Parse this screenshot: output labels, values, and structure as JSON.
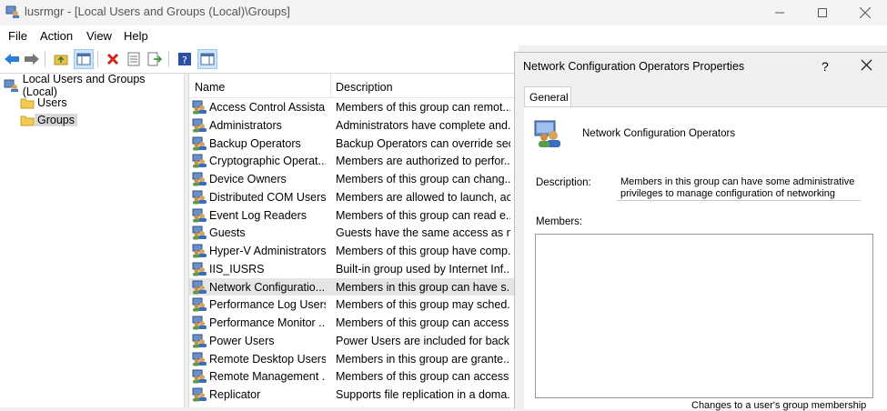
{
  "window": {
    "title": "lusrmgr - [Local Users and Groups (Local)\\Groups]"
  },
  "menu": [
    "File",
    "Action",
    "View",
    "Help"
  ],
  "toolbar_icons": [
    "back-arrow-icon",
    "forward-arrow-icon",
    "up-folder-icon",
    "show-hide-tree-icon",
    "delete-icon",
    "properties-icon",
    "export-list-icon",
    "help-icon",
    "show-hide-action-pane-icon"
  ],
  "tree": {
    "root": "Local Users and Groups (Local)",
    "children": [
      "Users",
      "Groups"
    ],
    "selected": "Groups"
  },
  "list": {
    "columns": [
      "Name",
      "Description"
    ],
    "rows": [
      {
        "name": "Access Control Assista...",
        "desc": "Members of this group can remot..."
      },
      {
        "name": "Administrators",
        "desc": "Administrators have complete and..."
      },
      {
        "name": "Backup Operators",
        "desc": "Backup Operators can override sec..."
      },
      {
        "name": "Cryptographic Operat...",
        "desc": "Members are authorized to perfor..."
      },
      {
        "name": "Device Owners",
        "desc": "Members of this group can chang..."
      },
      {
        "name": "Distributed COM Users",
        "desc": "Members are allowed to launch, ac..."
      },
      {
        "name": "Event Log Readers",
        "desc": "Members of this group can read e..."
      },
      {
        "name": "Guests",
        "desc": "Guests have the same access as m..."
      },
      {
        "name": "Hyper-V Administrators",
        "desc": "Members of this group have comp..."
      },
      {
        "name": "IIS_IUSRS",
        "desc": "Built-in group used by Internet Inf..."
      },
      {
        "name": "Network Configuratio...",
        "desc": "Members in this group can have s...",
        "selected": true
      },
      {
        "name": "Performance Log Users",
        "desc": "Members of this group may sched..."
      },
      {
        "name": "Performance Monitor ...",
        "desc": "Members of this group can access ..."
      },
      {
        "name": "Power Users",
        "desc": "Power Users are included for back..."
      },
      {
        "name": "Remote Desktop Users",
        "desc": "Members in this group are grante..."
      },
      {
        "name": "Remote Management ...",
        "desc": "Members of this group can access ..."
      },
      {
        "name": "Replicator",
        "desc": "Supports file replication in a doma..."
      }
    ]
  },
  "dialog": {
    "title": "Network Configuration Operators Properties",
    "help": "?",
    "tab": "General",
    "group_name": "Network Configuration Operators",
    "description_label": "Description:",
    "description": "Members in this group can have some administrative privileges to manage configuration of networking",
    "members_label": "Members:",
    "note": "Changes to a user's group membership"
  }
}
